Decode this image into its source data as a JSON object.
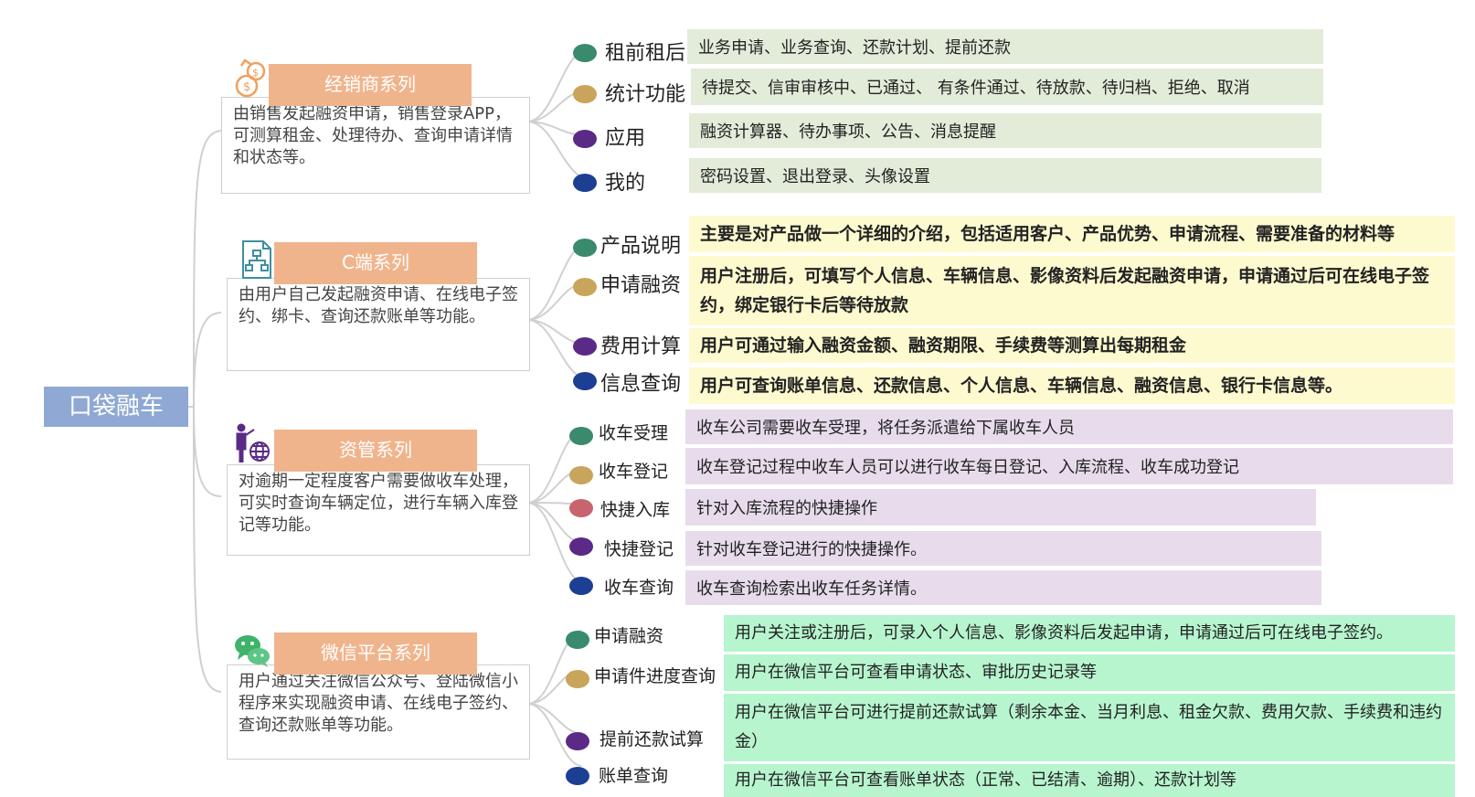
{
  "root": {
    "label": "口袋融车"
  },
  "categories": [
    {
      "title": "经销商系列",
      "icon": "money-bag-icon",
      "description": "由销售发起融资申请，销售登录APP，可测算租金、处理待办、查询申请详情和状态等。",
      "items": [
        {
          "label": "租前租后",
          "dot": "#3a8a6e",
          "text": "业务申请、业务查询、还款计划、提前还款"
        },
        {
          "label": "统计功能",
          "dot": "#c8a55a",
          "text": "待提交、信审审核中、已通过、 有条件通过、待放款、待归档、拒绝、取消"
        },
        {
          "label": "应用",
          "dot": "#5b2a86",
          "text": "融资计算器、待办事项、公告、消息提醒"
        },
        {
          "label": "我的",
          "dot": "#1c3f94",
          "text": "密码设置、退出登录、头像设置"
        }
      ]
    },
    {
      "title": "C端系列",
      "icon": "document-flowchart-icon",
      "description": "由用户自己发起融资申请、在线电子签约、绑卡、查询还款账单等功能。",
      "items": [
        {
          "label": "产品说明",
          "dot": "#3a8a6e",
          "text": "主要是对产品做一个详细的介绍，包括适用客户、产品优势、申请流程、需要准备的材料等"
        },
        {
          "label": "申请融资",
          "dot": "#c8a55a",
          "text": "用户注册后，可填写个人信息、车辆信息、影像资料后发起融资申请，申请通过后可在线电子签约，绑定银行卡后等待放款"
        },
        {
          "label": "费用计算",
          "dot": "#5b2a86",
          "text": "用户可通过输入融资金额、融资期限、手续费等测算出每期租金"
        },
        {
          "label": "信息查询",
          "dot": "#1c3f94",
          "text": "用户可查询账单信息、还款信息、个人信息、车辆信息、融资信息、银行卡信息等。"
        }
      ]
    },
    {
      "title": "资管系列",
      "icon": "person-globe-icon",
      "description": "对逾期一定程度客户需要做收车处理，可实时查询车辆定位，进行车辆入库登记等功能。",
      "items": [
        {
          "label": "收车受理",
          "dot": "#3a8a6e",
          "text": "收车公司需要收车受理，将任务派遣给下属收车人员"
        },
        {
          "label": "收车登记",
          "dot": "#c8a55a",
          "text": "收车登记过程中收车人员可以进行收车每日登记、入库流程、收车成功登记"
        },
        {
          "label": "快捷入库",
          "dot": "#c8646e",
          "text": "针对入库流程的快捷操作"
        },
        {
          "label": "快捷登记",
          "dot": "#5b2a86",
          "text": "针对收车登记进行的快捷操作。"
        },
        {
          "label": "收车查询",
          "dot": "#1c3f94",
          "text": "收车查询检索出收车任务详情。"
        }
      ]
    },
    {
      "title": "微信平台系列",
      "icon": "wechat-icon",
      "description": "用户通过关注微信公众号、登陆微信小程序来实现融资申请、在线电子签约、查询还款账单等功能。",
      "items": [
        {
          "label": "申请融资",
          "dot": "#3a8a6e",
          "text": "用户关注或注册后，可录入个人信息、影像资料后发起申请，申请通过后可在线电子签约。"
        },
        {
          "label": "申请件进度查询",
          "dot": "#c8a55a",
          "text": "用户在微信平台可查看申请状态、审批历史记录等"
        },
        {
          "label": "提前还款试算",
          "dot": "#5b2a86",
          "text": "用户在微信平台可进行提前还款试算（剩余本金、当月利息、租金欠款、费用欠款、手续费和违约金）"
        },
        {
          "label": "账单查询",
          "dot": "#1c3f94",
          "text": "用户在微信平台可查看账单状态（正常、已结清、逾期）、还款计划等"
        }
      ]
    }
  ]
}
